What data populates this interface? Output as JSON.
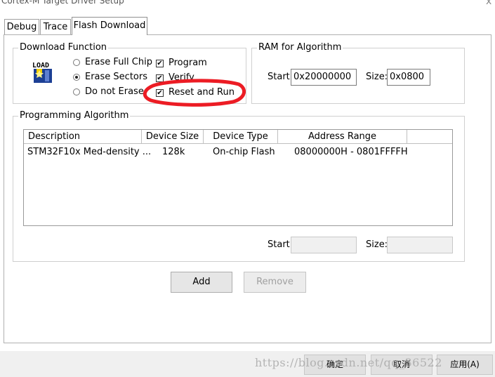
{
  "window": {
    "title": "Cortex-M Target Driver Setup",
    "close_glyph": "x"
  },
  "tabs": [
    {
      "label": "Debug"
    },
    {
      "label": "Trace"
    },
    {
      "label": "Flash Download",
      "active": true
    }
  ],
  "download_function": {
    "title": "Download Function",
    "icon": "load-icon",
    "icon_text": "LOAD",
    "radios": [
      {
        "label": "Erase Full Chip",
        "selected": false
      },
      {
        "label": "Erase Sectors",
        "selected": true
      },
      {
        "label": "Do not Erase",
        "selected": false
      }
    ],
    "checks": [
      {
        "label": "Program",
        "checked": true
      },
      {
        "label": "Verify",
        "checked": true
      },
      {
        "label": "Reset and Run",
        "checked": true
      }
    ],
    "check_glyph": "✔"
  },
  "ram": {
    "title": "RAM for Algorithm",
    "start_label": "Start:",
    "start_value": "0x20000000",
    "size_label": "Size:",
    "size_value": "0x0800"
  },
  "algorithm": {
    "title": "Programming Algorithm",
    "columns": [
      "Description",
      "Device Size",
      "Device Type",
      "Address Range"
    ],
    "rows": [
      [
        "STM32F10x Med-density ...",
        "128k",
        "On-chip Flash",
        "08000000H - 0801FFFFH"
      ]
    ],
    "start_label": "Start:",
    "start_value": "",
    "size_label": "Size:",
    "size_value": ""
  },
  "buttons": {
    "add": "Add",
    "remove": "Remove"
  },
  "footer": {
    "ok": "确定",
    "cancel": "取消",
    "apply": "应用(A)"
  },
  "watermark": "https://blog.csdn.net/qq_36522"
}
